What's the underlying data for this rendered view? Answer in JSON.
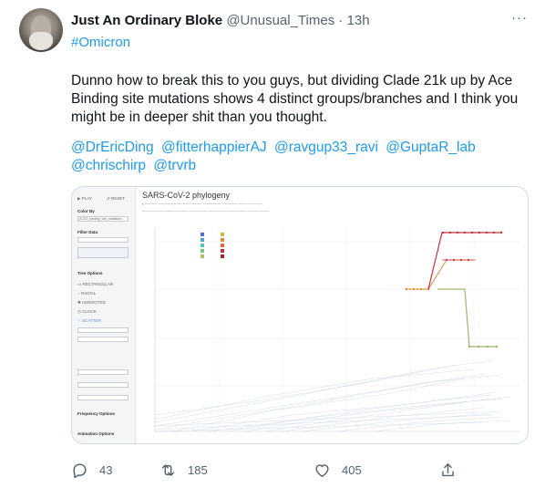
{
  "tweet": {
    "display_name": "Just An Ordinary Bloke",
    "handle": "@Unusual_Times",
    "separator": "·",
    "time": "13h",
    "hashtag": "#Omicron",
    "text": "Dunno how to break this to you guys, but dividing Clade 21k up by Ace Binding site mutations shows 4 distinct groups/branches and I think you might be in deeper shit than you thought.",
    "mentions": [
      "@DrEricDing",
      "@fitterhappierAJ",
      "@ravgup33_ravi",
      "@GuptaR_lab",
      "@chrischirp",
      "@trvrb"
    ],
    "replies": "43",
    "retweets": "185",
    "likes": "405"
  },
  "media": {
    "chart_title": "SARS-CoV-2 phylogeny",
    "sidebar": {
      "play": "PLAY",
      "reset": "RESET",
      "color_by": "Color By",
      "color_by_value": "ACE2_binding_site_mutations",
      "filter_data": "Filter Data",
      "tree_options": "Tree Options",
      "layouts": [
        "RECTANGULAR",
        "RADIAL",
        "UNROOTED",
        "CLOCK",
        "SCATTER"
      ],
      "frequency_options": "Frequency Options",
      "animation_options": "Animation Options"
    },
    "colors": {
      "link": "#1d9bf0",
      "muted": "#536471",
      "red_series": "#c0323a",
      "yellow_series": "#d4b83c",
      "orange_series": "#e08a3c",
      "green_series": "#9fb56a"
    }
  }
}
